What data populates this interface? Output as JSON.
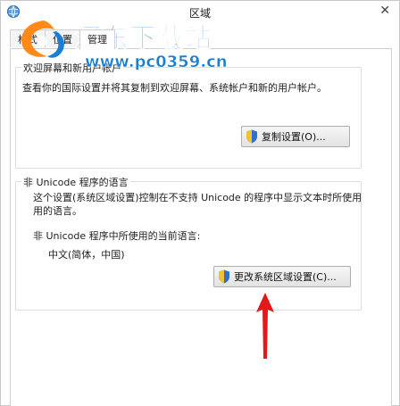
{
  "window": {
    "title": "区域",
    "close_glyph": "✕"
  },
  "tabs": [
    {
      "label": "格式"
    },
    {
      "label": "位置"
    },
    {
      "label": "管理"
    }
  ],
  "welcome_group": {
    "title": "欢迎屏幕和新用户帐户",
    "description": "查看你的国际设置并将其复制到欢迎屏幕、系统帐户和新的用户帐户。",
    "button_label": "复制设置(O)..."
  },
  "unicode_group": {
    "title": "非 Unicode 程序的语言",
    "description_line1": "这个设置(系统区域设置)控制在不支持 Unicode 的程序中显示文本时所使用",
    "description_line2": "用的语言。",
    "current_label": "非 Unicode 程序中所使用的当前语言:",
    "current_value": "中文(简体，中国)",
    "button_label": "更改系统区域设置(C)..."
  },
  "watermark": {
    "site_name": "河东下载站",
    "url": "www.pc0359.cn"
  },
  "icons": {
    "app": "region-globe-icon",
    "shield": "uac-shield-icon",
    "arrow": "red-arrow-annotation"
  },
  "colors": {
    "watermark_blue": "#1a7fd4",
    "arrow_red": "#e11919",
    "shield_blue": "#2f6fd0",
    "shield_yellow": "#f2c230"
  }
}
